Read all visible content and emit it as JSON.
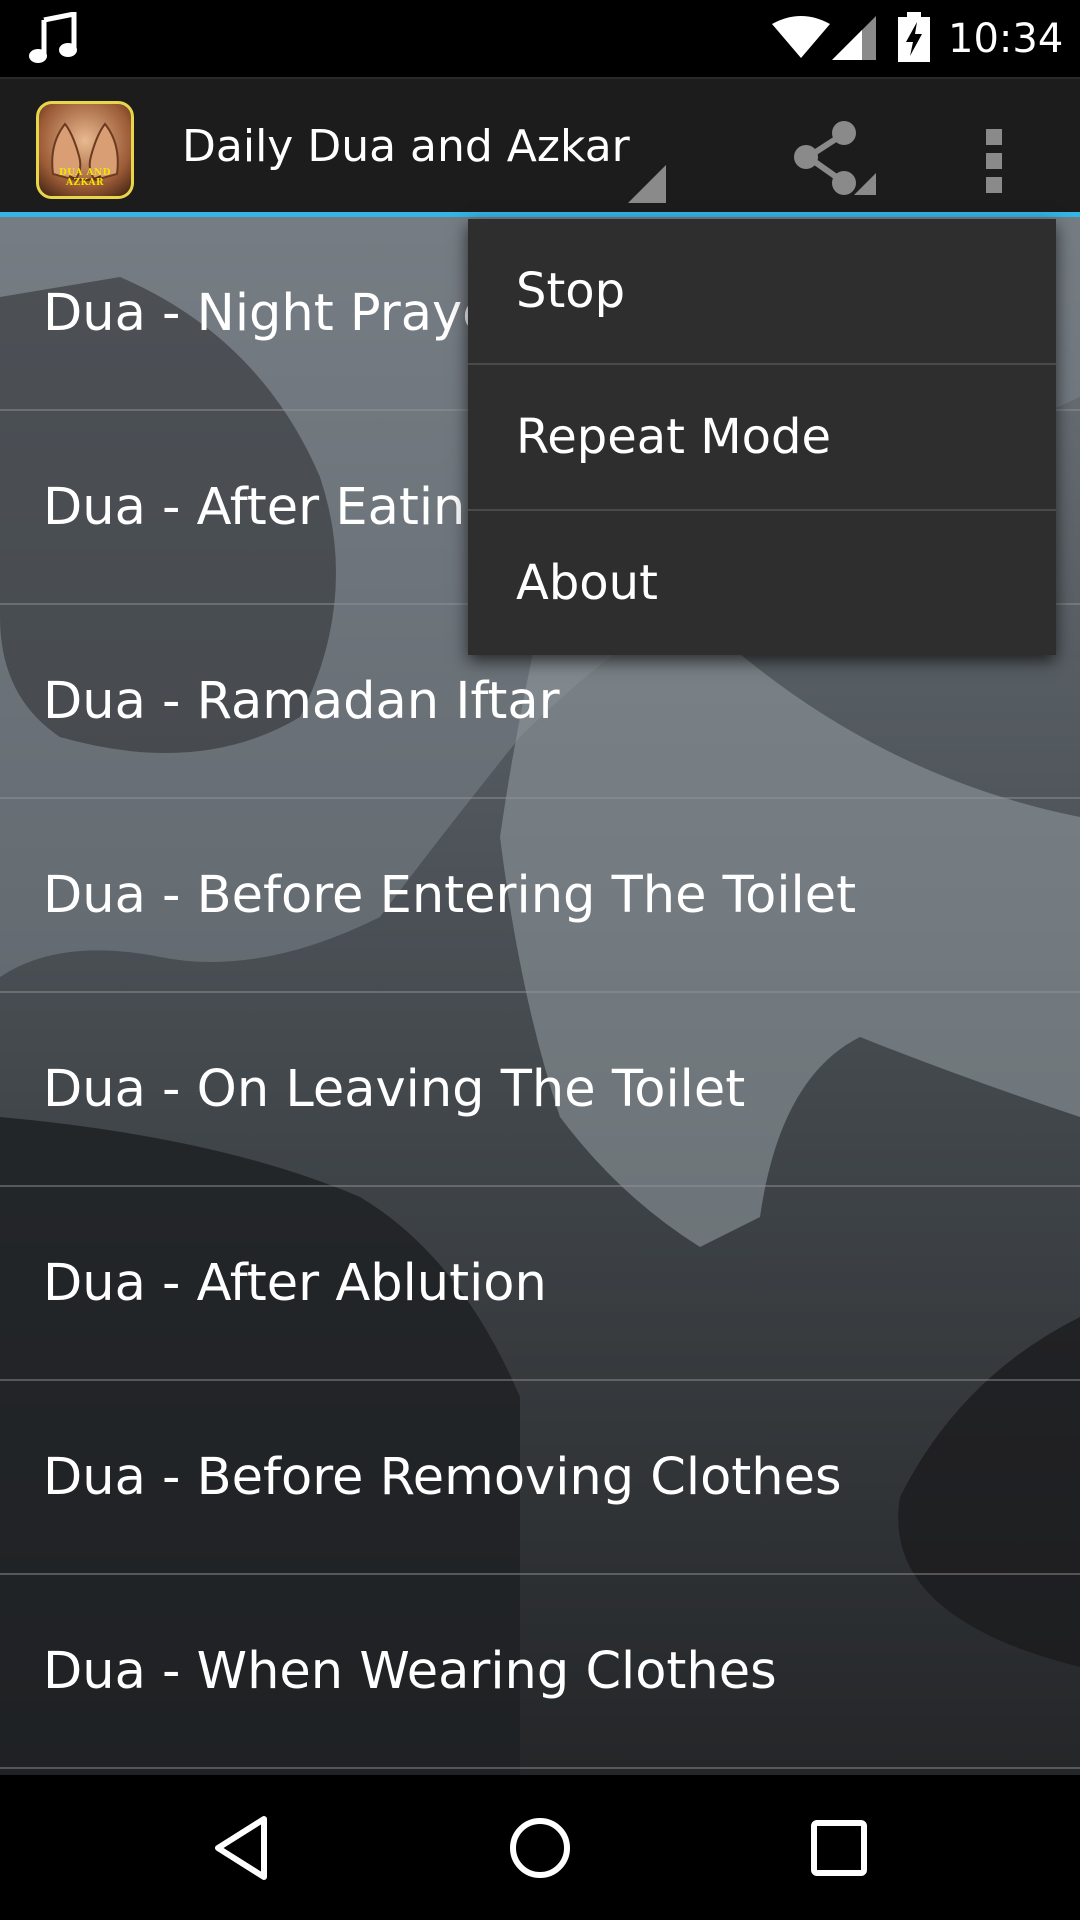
{
  "status_bar": {
    "time": "10:34",
    "icons": [
      "music-note-icon",
      "wifi-icon",
      "cell-signal-icon",
      "battery-charging-icon"
    ]
  },
  "action_bar": {
    "title": "Daily Dua and Azkar",
    "logo_text": "DUA AND AZKAR",
    "accent_color": "#33b5e5",
    "actions": [
      "share-icon",
      "overflow-menu-icon"
    ]
  },
  "list": {
    "items": [
      {
        "label": "Dua - Night Prayer"
      },
      {
        "label": "Dua - After Eating"
      },
      {
        "label": "Dua - Ramadan Iftar"
      },
      {
        "label": "Dua - Before Entering The Toilet"
      },
      {
        "label": "Dua - On Leaving The Toilet"
      },
      {
        "label": "Dua - After Ablution"
      },
      {
        "label": "Dua - Before Removing Clothes"
      },
      {
        "label": "Dua - When Wearing Clothes"
      }
    ]
  },
  "overflow_menu": {
    "items": [
      {
        "label": "Stop"
      },
      {
        "label": "Repeat Mode"
      },
      {
        "label": "About"
      }
    ]
  },
  "nav_bar": {
    "buttons": [
      "back-icon",
      "home-icon",
      "recents-icon"
    ]
  }
}
